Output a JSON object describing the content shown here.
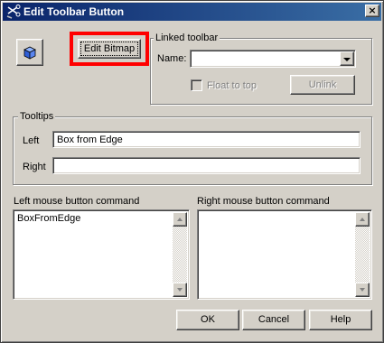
{
  "window": {
    "title": "Edit Toolbar Button",
    "icon": "scissors-app-icon",
    "close_glyph": "×"
  },
  "bitmap_preview": {
    "icon": "blue-box-icon"
  },
  "edit_bitmap_button": {
    "label": "Edit Bitmap",
    "highlight_color": "#ff0000"
  },
  "linked_toolbar": {
    "legend": "Linked toolbar",
    "name_label": "Name:",
    "name_value": "",
    "float_to_top_label": "Float to top",
    "float_to_top_checked": false,
    "unlink_label": "Unlink"
  },
  "tooltips": {
    "legend": "Tooltips",
    "left_label": "Left",
    "left_value": "Box from Edge",
    "right_label": "Right",
    "right_value": ""
  },
  "left_command": {
    "label": "Left mouse button command",
    "value": "BoxFromEdge"
  },
  "right_command": {
    "label": "Right mouse button command",
    "value": ""
  },
  "buttons": {
    "ok": "OK",
    "cancel": "Cancel",
    "help": "Help"
  },
  "colors": {
    "title_start": "#0a246a",
    "title_end": "#3a6ea5",
    "face": "#d4d0c8"
  }
}
